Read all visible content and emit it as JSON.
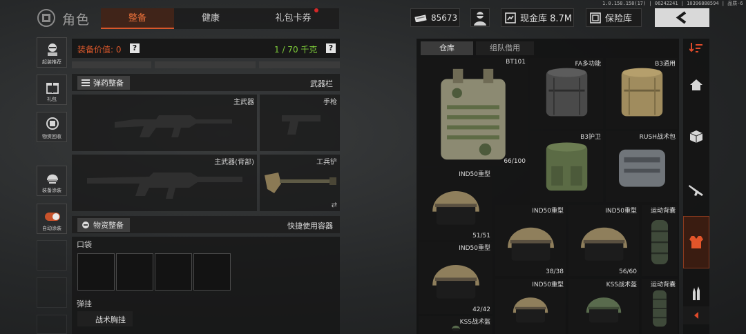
{
  "version": "1.0.158.158(17) | 06242241 | 10396888594 | 品质-6",
  "header": {
    "title": "角色",
    "tabs": [
      {
        "label": "整备",
        "active": true
      },
      {
        "label": "健康",
        "active": false
      },
      {
        "label": "礼包卡券",
        "active": false,
        "notification_dot": true
      }
    ],
    "currencies": [
      {
        "icon": "banknote-icon",
        "value": "85673"
      },
      {
        "icon": "safe-deposit-icon",
        "value": "现金库 8.7M"
      },
      {
        "icon": "vault-icon",
        "value": "保险库"
      }
    ],
    "avatar_icon": "character-avatar-icon",
    "back_icon": "chevron-left-icon"
  },
  "sidebar": {
    "items": [
      {
        "label": "起装推荐",
        "icon": "recommend-gear-icon"
      },
      {
        "label": "礼包",
        "icon": "gift-icon"
      },
      {
        "label": "物资回收",
        "icon": "recycle-icon"
      },
      {
        "label": "装备涂装",
        "icon": "paint-helmet-icon"
      },
      {
        "label": "自动涂装",
        "icon": "toggle-icon"
      }
    ]
  },
  "equipment": {
    "value_label": "装备价值: 0",
    "weight": "1 / 70 千克",
    "ammo_button": "弹药整备",
    "weapons_header": "武器栏",
    "slots": {
      "primary": "主武器",
      "pistol": "手枪",
      "primary_back": "主武器(背部)",
      "shovel": "工兵铲"
    },
    "supply_button": "物资整备",
    "quick_use": "快捷使用容器",
    "pocket_label": "口袋",
    "rig_label": "弹挂",
    "rig_item": "战术胸挂"
  },
  "warehouse": {
    "tabs": [
      {
        "label": "仓库",
        "active": true
      },
      {
        "label": "组队借用",
        "active": false
      }
    ],
    "items": [
      {
        "name": "BT101",
        "durability": "66/100",
        "kind": "armor"
      },
      {
        "name": "FA多功能",
        "durability": "",
        "kind": "bag-dark"
      },
      {
        "name": "B3通用",
        "durability": "",
        "kind": "bag-tan"
      },
      {
        "name": "B3护卫",
        "durability": "",
        "kind": "bag-green"
      },
      {
        "name": "RUSH战术包",
        "durability": "",
        "kind": "bag-grey"
      },
      {
        "name": "IND50重型",
        "durability": "51/51",
        "kind": "helmet"
      },
      {
        "name": "IND50重型",
        "durability": "38/38",
        "kind": "helmet"
      },
      {
        "name": "IND50重型",
        "durability": "56/60",
        "kind": "helmet"
      },
      {
        "name": "运动背囊",
        "durability": "",
        "kind": "roll"
      },
      {
        "name": "IND50重型",
        "durability": "42/42",
        "kind": "helmet"
      },
      {
        "name": "IND50重型",
        "durability": "",
        "kind": "helmet"
      },
      {
        "name": "KSS战术盔",
        "durability": "",
        "kind": "helmet-green"
      },
      {
        "name": "运动背囊",
        "durability": "",
        "kind": "roll"
      },
      {
        "name": "KSS战术盔",
        "durability": "",
        "kind": "helmet-green"
      }
    ]
  },
  "right_rail": {
    "items": [
      {
        "icon": "sort-icon",
        "active": false
      },
      {
        "icon": "home-icon",
        "active": false
      },
      {
        "icon": "box-icon",
        "active": false
      },
      {
        "icon": "rifle-icon",
        "active": false
      },
      {
        "icon": "vest-icon",
        "active": true
      },
      {
        "icon": "ammo-icon",
        "active": false
      },
      {
        "icon": "collapse-left-icon",
        "active": false
      }
    ]
  },
  "colors": {
    "accent": "#d8572b",
    "value_label": "#d8572b",
    "weight": "#7fce3a"
  }
}
